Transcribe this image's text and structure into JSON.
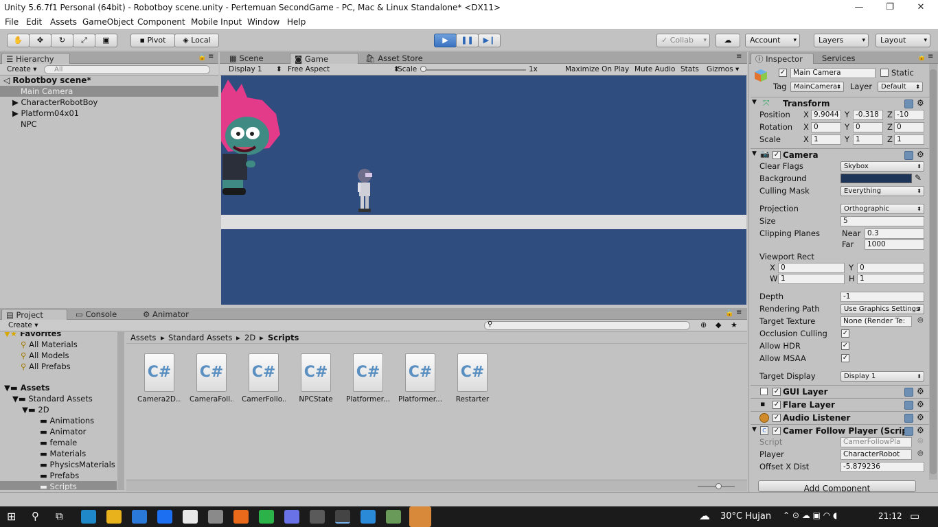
{
  "window": {
    "title": "Unity 5.6.7f1 Personal (64bit) - Robotboy scene.unity - Pertemuan SecondGame - PC, Mac & Linux Standalone* <DX11>",
    "minimize": "—",
    "restore": "❐",
    "close": "✕"
  },
  "menu": [
    "File",
    "Edit",
    "Assets",
    "GameObject",
    "Component",
    "Mobile Input",
    "Window",
    "Help"
  ],
  "toolbar": {
    "pivot": "Pivot",
    "local": "Local",
    "collab": "Collab",
    "account": "Account",
    "layers": "Layers",
    "layout": "Layout",
    "play_state": "playing"
  },
  "hierarchy": {
    "tab": "Hierarchy",
    "create": "Create",
    "search_placeholder": "All",
    "scene": "Robotboy scene*",
    "items": [
      "Main Camera",
      "CharacterRobotBoy",
      "Platform04x01",
      "NPC"
    ]
  },
  "game": {
    "tabs": [
      "Scene",
      "Game",
      "Asset Store"
    ],
    "display": "Display 1",
    "aspect": "Free Aspect",
    "scale_label": "Scale",
    "scale_value": "1x",
    "maximize": "Maximize On Play",
    "mute": "Mute Audio",
    "stats": "Stats",
    "gizmos": "Gizmos",
    "colors": {
      "sky": "#2f4d7e",
      "platform": "#dedede"
    }
  },
  "project": {
    "tabs": [
      "Project",
      "Console",
      "Animator"
    ],
    "create": "Create",
    "favorites_label": "Favorites",
    "favorites": [
      "All Materials",
      "All Models",
      "All Prefabs"
    ],
    "assets_label": "Assets",
    "tree": [
      "Standard Assets",
      "2D",
      "Animations",
      "Animator",
      "female",
      "Materials",
      "PhysicsMaterials",
      "Prefabs",
      "Scripts"
    ],
    "breadcrumb": [
      "Assets",
      "Standard Assets",
      "2D",
      "Scripts"
    ],
    "files": [
      "Camera2D...",
      "CameraFoll...",
      "CamerFollo...",
      "NPCState",
      "Platformer...",
      "Platformer...",
      "Restarter"
    ]
  },
  "inspector": {
    "tabs": [
      "Inspector",
      "Services"
    ],
    "object_name": "Main Camera",
    "static": "Static",
    "tag_label": "Tag",
    "tag": "MainCamera",
    "layer_label": "Layer",
    "layer": "Default",
    "transform": {
      "title": "Transform",
      "rows": [
        {
          "label": "Position",
          "x": "9.9044",
          "y": "-0.318",
          "z": "-10"
        },
        {
          "label": "Rotation",
          "x": "0",
          "y": "0",
          "z": "0"
        },
        {
          "label": "Scale",
          "x": "1",
          "y": "1",
          "z": "1"
        }
      ]
    },
    "camera": {
      "title": "Camera",
      "clear_flags_label": "Clear Flags",
      "clear_flags": "Skybox",
      "background_label": "Background",
      "background_color": "#1f3558",
      "culling_label": "Culling Mask",
      "culling": "Everything",
      "projection_label": "Projection",
      "projection": "Orthographic",
      "size_label": "Size",
      "size": "5",
      "clipping_label": "Clipping Planes",
      "near_label": "Near",
      "near": "0.3",
      "far_label": "Far",
      "far": "1000",
      "viewport_label": "Viewport Rect",
      "vx": "0",
      "vy": "0",
      "vw": "1",
      "vh": "1",
      "depth_label": "Depth",
      "depth": "-1",
      "rendering_label": "Rendering Path",
      "rendering": "Use Graphics Settings",
      "target_label": "Target Texture",
      "target": "None (Render Te:",
      "occlusion_label": "Occlusion Culling",
      "hdr_label": "Allow HDR",
      "msaa_label": "Allow MSAA",
      "display_label": "Target Display",
      "display": "Display 1"
    },
    "components": [
      "GUI Layer",
      "Flare Layer",
      "Audio Listener"
    ],
    "script_comp": {
      "title": "Camer Follow Player (Scrip",
      "script_label": "Script",
      "script": "CamerFollowPla",
      "player_label": "Player",
      "player": "CharacterRobot",
      "offset_label": "Offset X Dist",
      "offset": "-5.879236"
    },
    "add_component": "Add Component"
  },
  "taskbar": {
    "weather": "30°C  Hujan",
    "time": "21:12"
  }
}
